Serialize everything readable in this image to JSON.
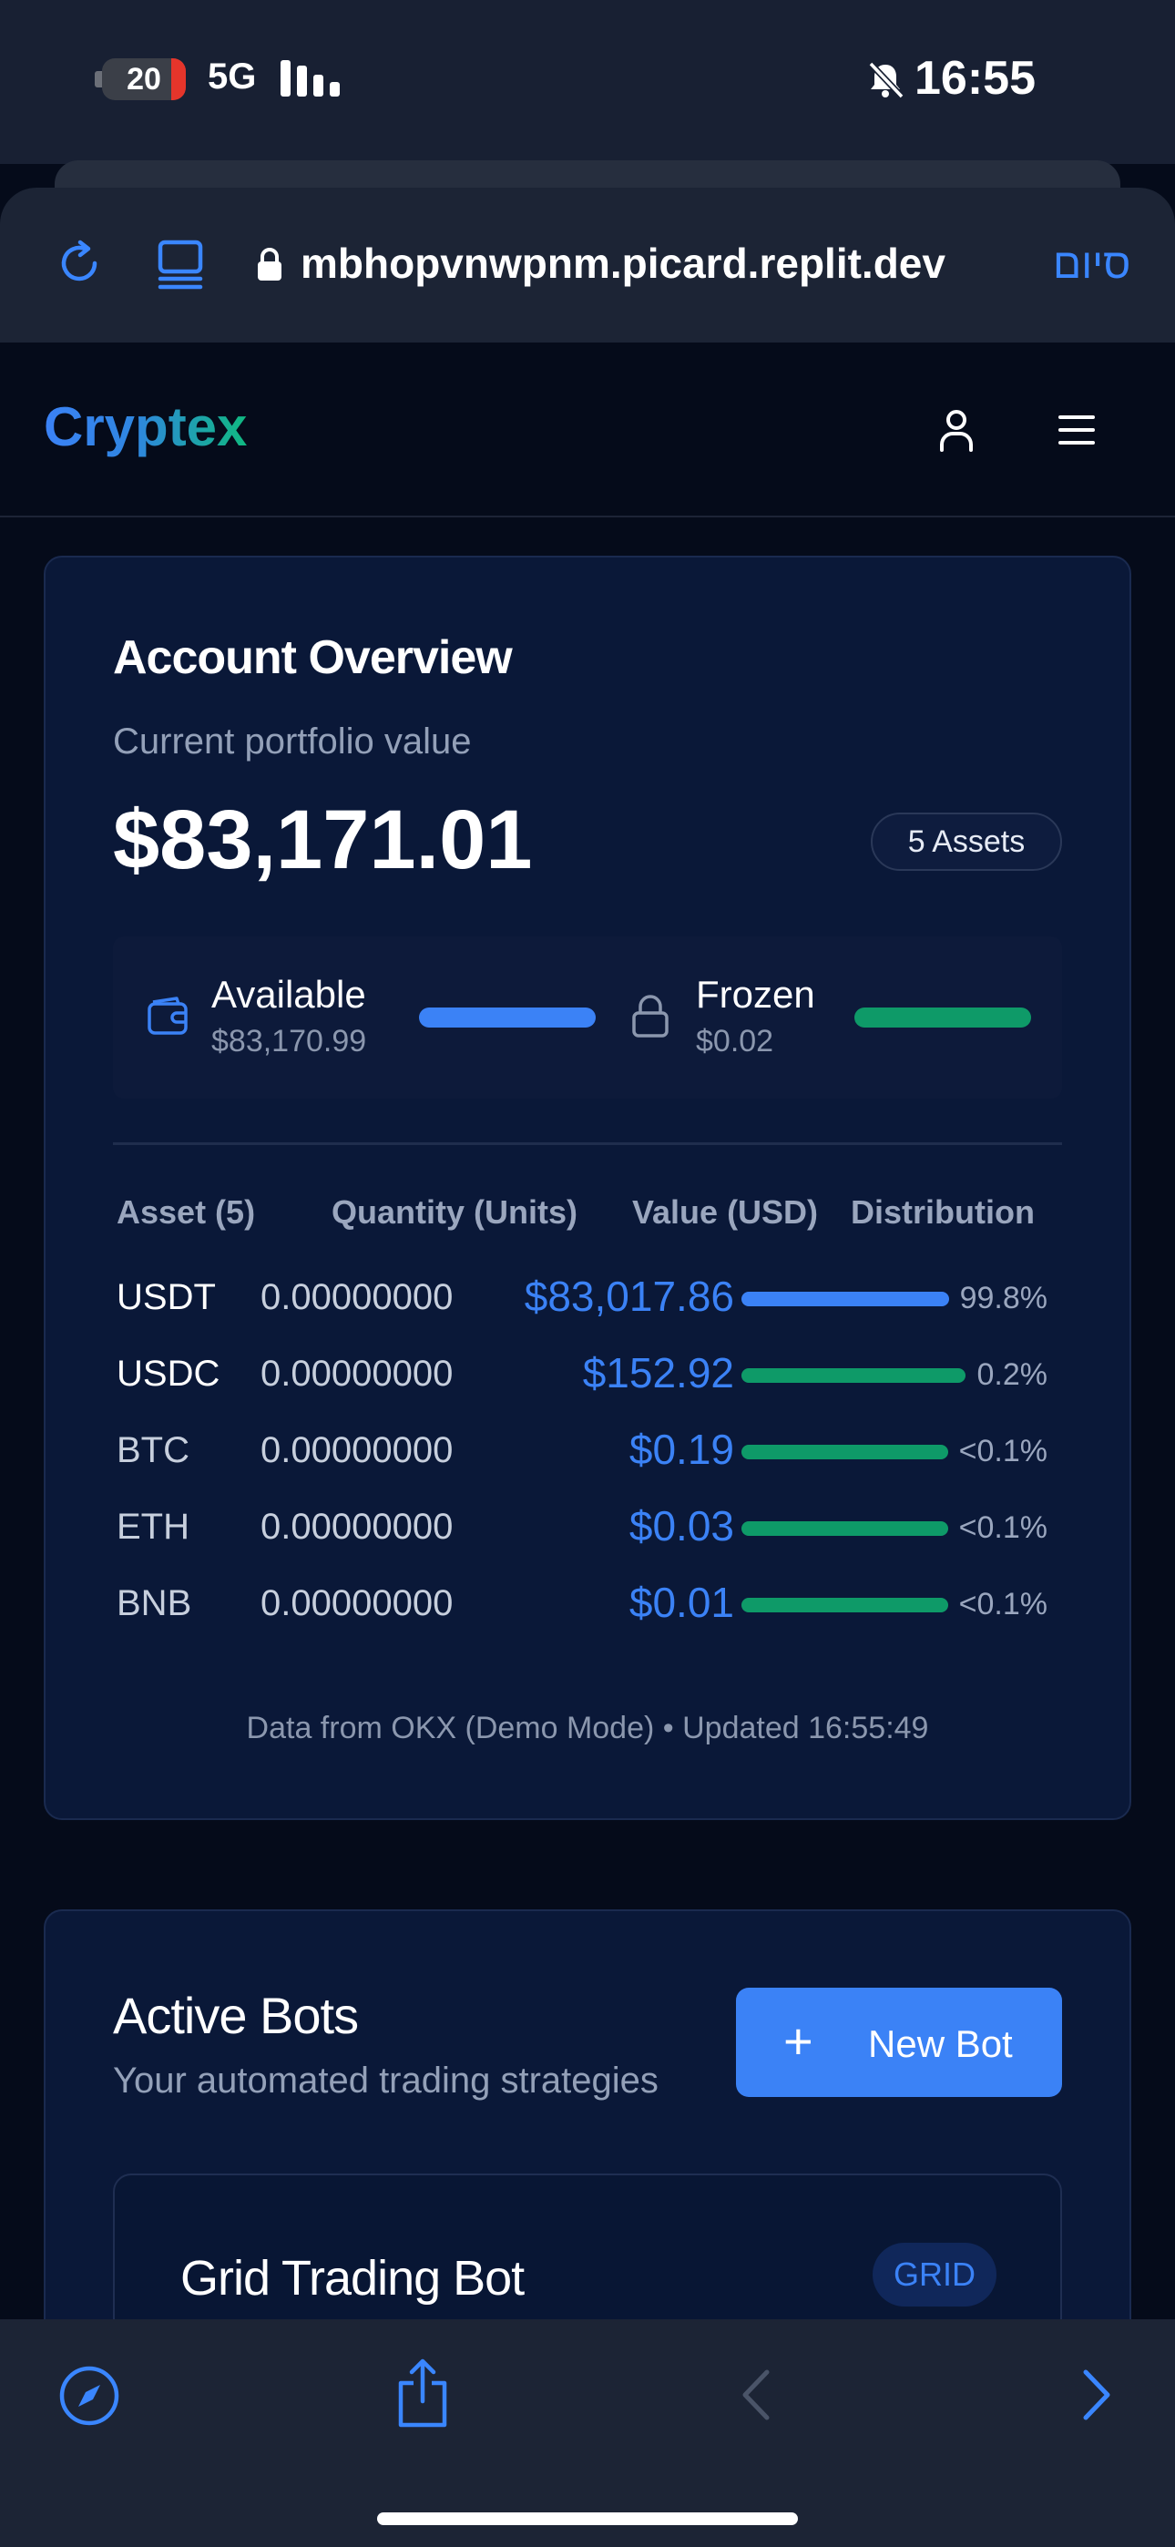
{
  "status_bar": {
    "battery": "20",
    "network": "5G",
    "time": "16:55",
    "icons": [
      "battery-icon",
      "signal-icon",
      "silent-bell-icon"
    ]
  },
  "browser": {
    "url": "mbhopvnwpnm.picard.replit.dev",
    "done_label": "סיום",
    "accent": "#3a86ff",
    "icons": [
      "reload-icon",
      "tabs-icon",
      "lock-icon",
      "compass-icon",
      "share-icon",
      "back-icon",
      "forward-icon"
    ]
  },
  "header": {
    "logo": "Cryptex",
    "icons": [
      "user-icon",
      "menu-icon"
    ]
  },
  "overview": {
    "title": "Account Overview",
    "subtitle": "Current portfolio value",
    "value": "$83,171.01",
    "assets_badge": "5 Assets",
    "available": {
      "label": "Available",
      "value": "$83,170.99"
    },
    "frozen": {
      "label": "Frozen",
      "value": "$0.02"
    },
    "table": {
      "headers": [
        "Asset (5)",
        "Quantity (Units)",
        "Value (USD)",
        "Distribution"
      ],
      "rows": [
        {
          "symbol": "USDT",
          "quantity": "0.00000000",
          "value": "$83,017.86",
          "pct": "99.8%",
          "distribution": 99.8,
          "color": "#3b82f6"
        },
        {
          "symbol": "USDC",
          "quantity": "0.00000000",
          "value": "$152.92",
          "pct": "0.2%",
          "distribution": 0.2,
          "color": "#0e9a68"
        },
        {
          "symbol": "BTC",
          "quantity": "0.00000000",
          "value": "$0.19",
          "pct": "<0.1%",
          "distribution": 0.1,
          "color": "#0e9a68"
        },
        {
          "symbol": "ETH",
          "quantity": "0.00000000",
          "value": "$0.03",
          "pct": "<0.1%",
          "distribution": 0.1,
          "color": "#0e9a68"
        },
        {
          "symbol": "BNB",
          "quantity": "0.00000000",
          "value": "$0.01",
          "pct": "<0.1%",
          "distribution": 0.1,
          "color": "#0e9a68"
        }
      ]
    },
    "footer": "Data from OKX (Demo Mode) • Updated 16:55:49"
  },
  "bots": {
    "title": "Active Bots",
    "subtitle": "Your automated trading strategies",
    "new_bot_label": "New Bot",
    "items": [
      {
        "name": "Grid Trading Bot",
        "badge": "GRID"
      }
    ]
  }
}
